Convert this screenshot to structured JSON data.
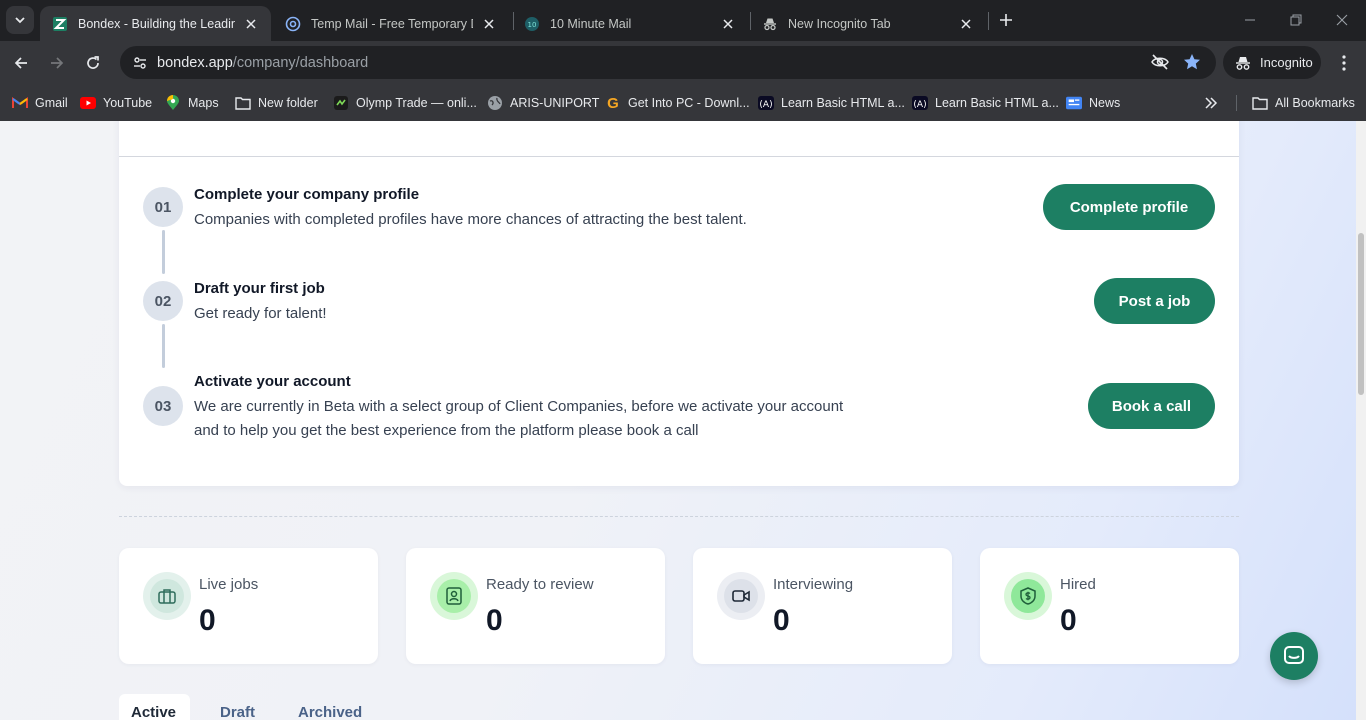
{
  "browser": {
    "tabs": [
      {
        "title": "Bondex - Building the Leading W",
        "favicon": "bondex-icon",
        "active": true
      },
      {
        "title": "Temp Mail - Free Temporary Dis",
        "favicon": "at-sign-icon",
        "active": false
      },
      {
        "title": "10 Minute Mail",
        "favicon": "10-minute-mail-icon",
        "active": false
      },
      {
        "title": "New Incognito Tab",
        "favicon": "incognito-icon",
        "active": false
      }
    ],
    "url_host": "bondex.app",
    "url_path": "/company/dashboard",
    "incognito_label": "Incognito",
    "bookmarks": [
      {
        "label": "Gmail",
        "icon": "gmail-icon"
      },
      {
        "label": "YouTube",
        "icon": "youtube-icon"
      },
      {
        "label": "Maps",
        "icon": "maps-icon"
      },
      {
        "label": "New folder",
        "icon": "folder-icon"
      },
      {
        "label": "Olymp Trade — onli...",
        "icon": "olymp-trade-icon"
      },
      {
        "label": "ARIS-UNIPORT",
        "icon": "globe-icon"
      },
      {
        "label": "Get Into PC - Downl...",
        "icon": "g-icon"
      },
      {
        "label": "Learn Basic HTML a...",
        "icon": "learn-html-icon"
      },
      {
        "label": "Learn Basic HTML a...",
        "icon": "learn-html-icon"
      },
      {
        "label": "News",
        "icon": "news-icon"
      }
    ],
    "all_bookmarks_label": "All Bookmarks"
  },
  "steps": [
    {
      "number": "01",
      "title": "Complete your company profile",
      "desc_lines": [
        "Companies with completed profiles have more chances of attracting the best talent."
      ],
      "button": "Complete profile"
    },
    {
      "number": "02",
      "title": "Draft your first job",
      "desc_lines": [
        "Get ready for talent!"
      ],
      "button": "Post a job"
    },
    {
      "number": "03",
      "title": "Activate your account",
      "desc_lines": [
        "We are currently in Beta with a select group of Client Companies, before we activate your account",
        "and to help you get the best experience from the platform please book a call"
      ],
      "button": "Book a call"
    }
  ],
  "stats": [
    {
      "label": "Live jobs",
      "value": "0",
      "icon": "briefcase-icon"
    },
    {
      "label": "Ready to review",
      "value": "0",
      "icon": "profile-card-icon"
    },
    {
      "label": "Interviewing",
      "value": "0",
      "icon": "video-camera-icon"
    },
    {
      "label": "Hired",
      "value": "0",
      "icon": "shield-dollar-icon"
    }
  ],
  "job_tabs": [
    {
      "label": "Active",
      "active": true
    },
    {
      "label": "Draft",
      "active": false
    },
    {
      "label": "Archived",
      "active": false
    }
  ],
  "colors": {
    "accent": "#1d7f63",
    "chrome_dark": "#202124",
    "chrome_mid": "#35363a"
  }
}
